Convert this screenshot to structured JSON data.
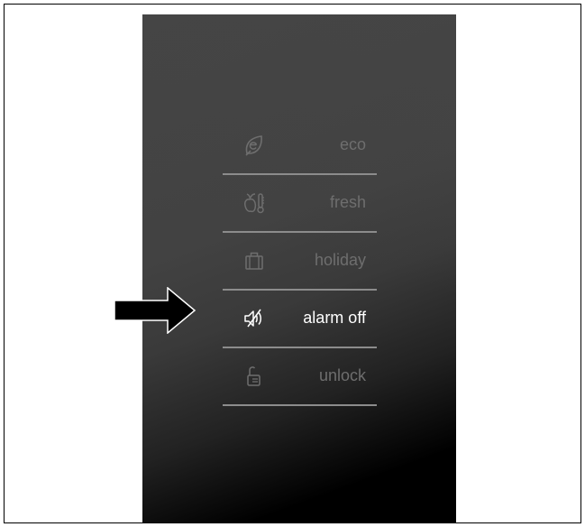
{
  "menu": {
    "items": [
      {
        "label": "eco",
        "icon": "eco-leaf-icon",
        "active": false
      },
      {
        "label": "fresh",
        "icon": "fresh-apple-thermometer-icon",
        "active": false
      },
      {
        "label": "holiday",
        "icon": "holiday-suitcase-icon",
        "active": false
      },
      {
        "label": "alarm off",
        "icon": "alarm-off-speaker-muted-icon",
        "active": true
      },
      {
        "label": "unlock",
        "icon": "unlock-padlock-icon",
        "active": false
      }
    ]
  },
  "colors": {
    "panel": "#424242",
    "label_inactive": "#6e6e6e",
    "label_active": "#ffffff",
    "divider": "#8c8c8c",
    "icon_inactive": "#6e6e6e",
    "icon_active": "#ffffff",
    "arrow": "#000000"
  }
}
